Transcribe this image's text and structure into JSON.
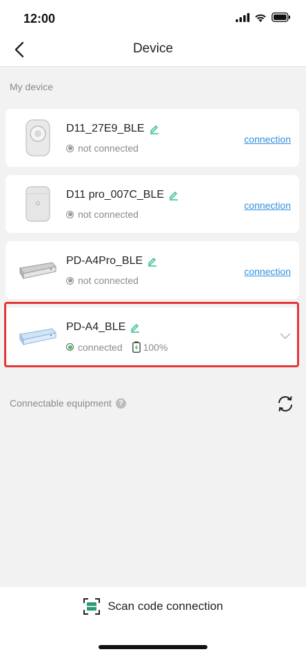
{
  "status_bar": {
    "time": "12:00"
  },
  "nav": {
    "title": "Device"
  },
  "my_device_label": "My device",
  "devices": [
    {
      "name": "D11_27E9_BLE",
      "status": "not connected",
      "action": "connection"
    },
    {
      "name": "D11 pro_007C_BLE",
      "status": "not connected",
      "action": "connection"
    },
    {
      "name": "PD-A4Pro_BLE",
      "status": "not connected",
      "action": "connection"
    },
    {
      "name": "PD-A4_BLE",
      "status": "connected",
      "battery": "100%"
    }
  ],
  "connectable_label": "Connectable equipment",
  "help_glyph": "?",
  "bottom": {
    "scan_label": "Scan code connection"
  },
  "colors": {
    "accent": "#2f8fdc",
    "edit_icon": "#3dbf9a",
    "highlight": "#e43636",
    "connected": "#3cc45a"
  },
  "icons": [
    "back-arrow-icon",
    "edit-pencil-icon",
    "battery-charging-icon",
    "chevron-down-icon",
    "refresh-icon",
    "help-icon",
    "scan-qr-icon"
  ]
}
